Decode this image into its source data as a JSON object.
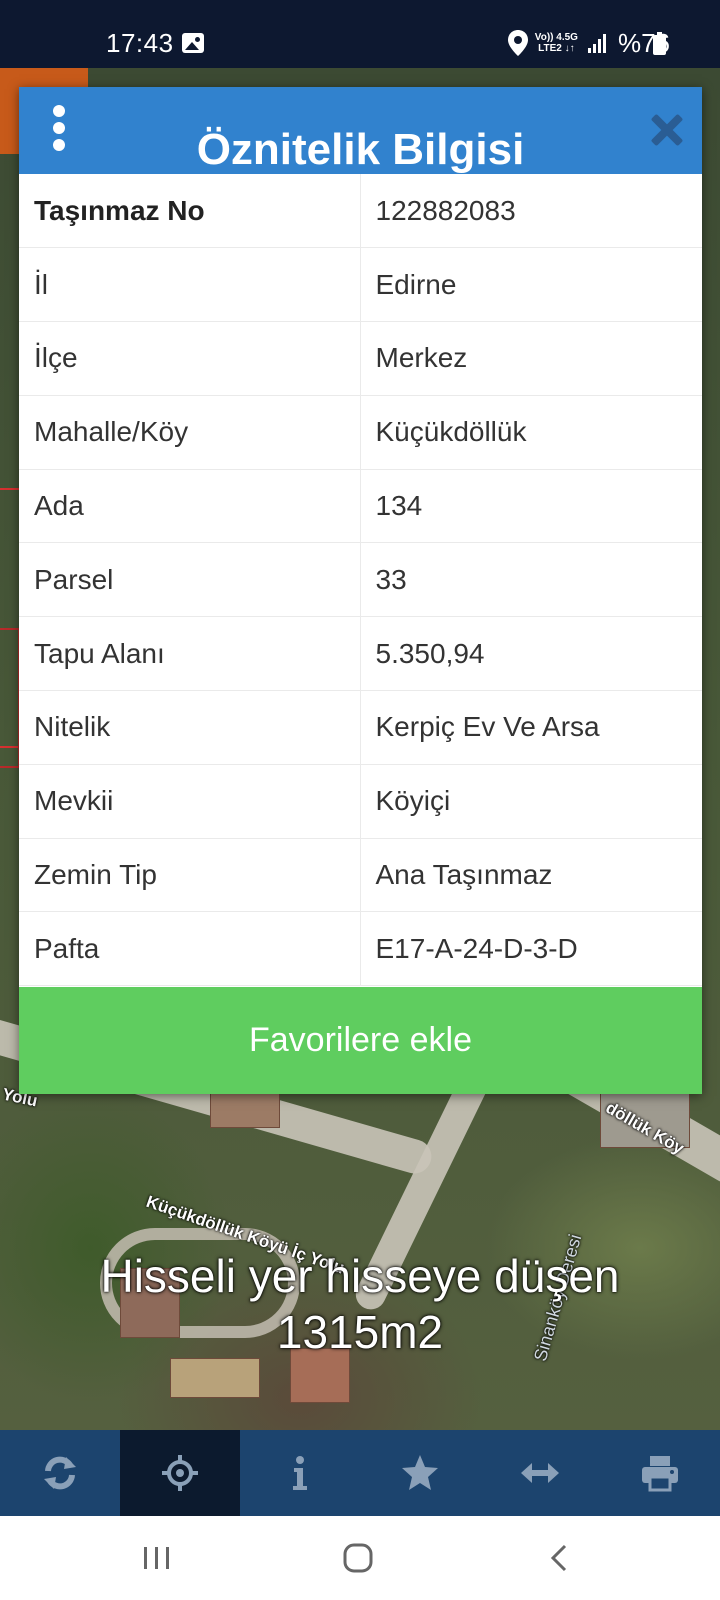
{
  "status_bar": {
    "time": "17:43",
    "network_top": "Vo)) 4.5G",
    "network_bottom": "LTE2 ↓↑",
    "battery": "%76",
    "icons": [
      "gallery-icon",
      "location-icon",
      "signal-icon",
      "battery-icon"
    ]
  },
  "map": {
    "labels": {
      "road_left": "Yolu",
      "road_center": "Küçükdöllük Köyü İç Yolu",
      "road_right": "döllük Köy",
      "stream": "Sinanköy Deresi"
    }
  },
  "dialog": {
    "title": "Öznitelik Bilgisi",
    "rows": [
      {
        "key": "Taşınmaz No",
        "value": "122882083"
      },
      {
        "key": "İl",
        "value": "Edirne"
      },
      {
        "key": "İlçe",
        "value": "Merkez"
      },
      {
        "key": "Mahalle/Köy",
        "value": "Küçükdöllük"
      },
      {
        "key": "Ada",
        "value": "134"
      },
      {
        "key": "Parsel",
        "value": "33"
      },
      {
        "key": "Tapu Alanı",
        "value": "5.350,94"
      },
      {
        "key": "Nitelik",
        "value": "Kerpiç Ev Ve Arsa"
      },
      {
        "key": "Mevkii",
        "value": "Köyiçi"
      },
      {
        "key": "Zemin Tip",
        "value": "Ana Taşınmaz"
      },
      {
        "key": "Pafta",
        "value": "E17-A-24-D-3-D"
      }
    ],
    "favorite_label": "Favorilere ekle"
  },
  "overlay": {
    "line1": "Hisseli yer hisseye düşen",
    "line2": "1315m2"
  },
  "toolbar": {
    "items": [
      "refresh-icon",
      "crosshair-icon",
      "info-icon",
      "star-icon",
      "measure-icon",
      "print-icon"
    ],
    "active": "crosshair-icon"
  },
  "colors": {
    "header": "#3182ce",
    "favorite_button": "#5fcd5f",
    "toolbar": "#1c446e",
    "toolbar_active": "#0c1a2e"
  }
}
